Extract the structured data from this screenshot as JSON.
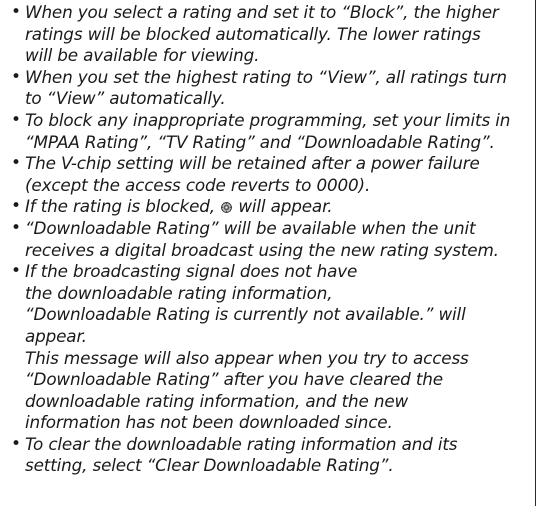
{
  "notes": [
    {
      "lines": [
        "When you select a rating and set it to “Block”, the higher",
        "ratings will be blocked automatically. The lower ratings",
        "will be available for viewing."
      ]
    },
    {
      "lines": [
        "When you set the highest rating to “View”, all ratings turn",
        "to “View” automatically."
      ]
    },
    {
      "lines": [
        "To block any inappropriate programming, set your limits in",
        "“MPAA Rating”, “TV Rating” and “Downloadable Rating”."
      ]
    },
    {
      "lines": [
        "The V-chip setting will be retained after a power failure",
        "(except the access code reverts to 0000)."
      ]
    },
    {
      "before_icon": "If the rating is blocked,",
      "icon": "blocked-rating-icon",
      "after_icon": "will appear."
    },
    {
      "lines": [
        "“Downloadable Rating” will be available when the unit",
        "receives a digital broadcast using the new rating system."
      ]
    },
    {
      "lines": [
        "If the broadcasting signal does not have",
        "the downloadable rating information,",
        "“Downloadable Rating is currently not available.” will",
        "appear.",
        "This message will also appear when you try to access",
        "“Downloadable Rating” after you have cleared the",
        "downloadable rating information, and the new",
        "information has not been downloaded since."
      ]
    },
    {
      "lines": [
        "To clear the downloadable rating information and its",
        "setting, select “Clear Downloadable Rating”."
      ]
    }
  ]
}
